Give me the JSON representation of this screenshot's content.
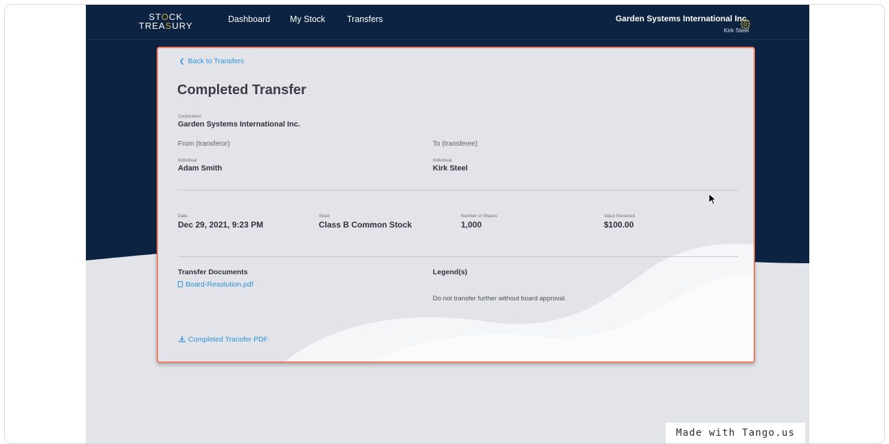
{
  "header": {
    "logo_line1": "ST",
    "logo_line1_tail": "CK",
    "logo_line2_head": "TREA",
    "logo_line2_tail": "URY",
    "logo_glyph": "O",
    "logo_glyph2": "S",
    "nav": [
      "Dashboard",
      "My Stock",
      "Transfers"
    ],
    "corporation_name": "Garden Systems International Inc.",
    "user_name": "Kirk Steel",
    "settings_icon": "gear-icon"
  },
  "transfer": {
    "back_link": "Back to Transfers",
    "title": "Completed Transfer",
    "corporation_label": "Corporation",
    "corporation_value": "Garden Systems International Inc.",
    "from_heading": "From (transferor)",
    "to_heading": "To (transferee)",
    "from_type": "Individual",
    "from_name": "Adam Smith",
    "to_type": "Individual",
    "to_name": "Kirk Steel",
    "date_label": "Date",
    "date_value": "Dec 29, 2021, 9:23 PM",
    "stock_label": "Stock",
    "stock_value": "Class B Common Stock",
    "shares_label": "Number of Shares",
    "shares_value": "1,000",
    "value_label": "Value Received",
    "value_value": "$100.00",
    "documents_heading": "Transfer Documents",
    "document_file": "Board-Resolution.pdf",
    "legends_heading": "Legend(s)",
    "legend_text": "Do not transfer further without board approval.",
    "download_link": "Completed Transfer PDF"
  },
  "watermark": "Made with Tango.us",
  "colors": {
    "navy": "#0d2342",
    "accent_link": "#2d8fd6",
    "highlight_border": "#ec7b5c",
    "page_bg": "#e2e4ea",
    "logo_gold": "#c9a640"
  }
}
